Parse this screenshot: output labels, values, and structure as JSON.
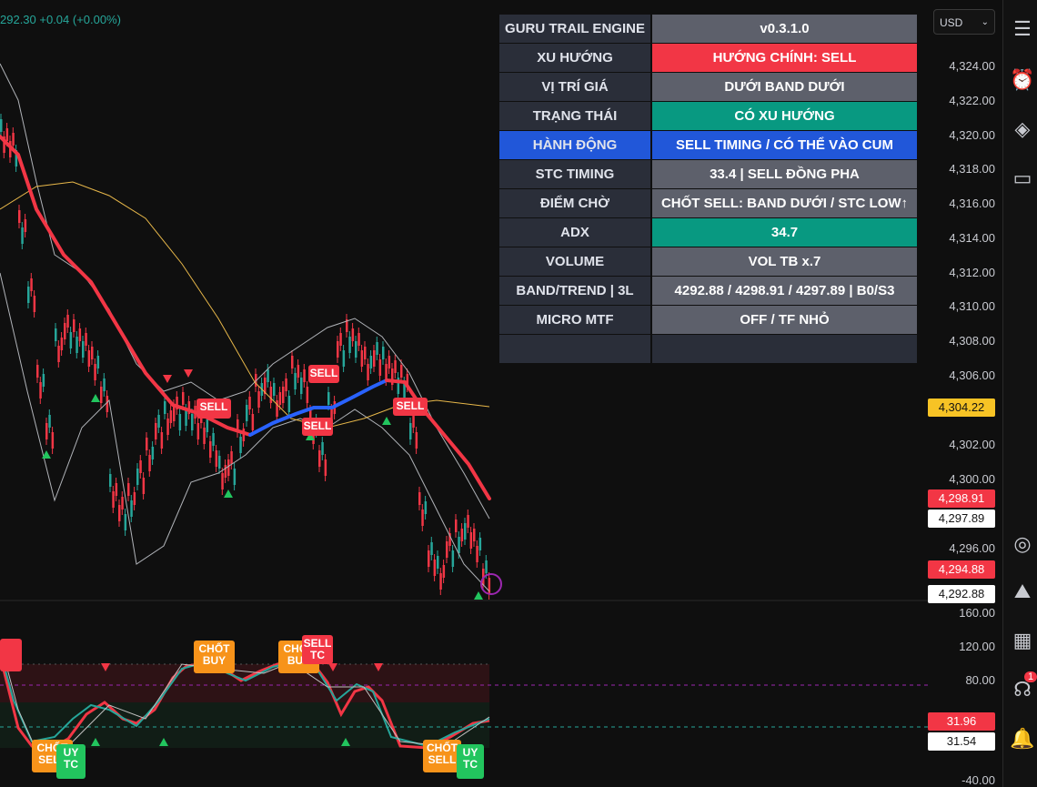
{
  "header": {
    "quote_text": "292.30 +0.04 (+0.00%)"
  },
  "currency": {
    "value": "USD"
  },
  "table": {
    "rows": [
      {
        "label": "GURU TRAIL ENGINE",
        "value": "v0.3.1.0",
        "value_color": "#5d606b"
      },
      {
        "label": "XU HƯỚNG",
        "value": "HƯỚNG CHÍNH: SELL",
        "value_color": "#f23645"
      },
      {
        "label": "VỊ TRÍ GIÁ",
        "value": "DƯỚI BAND DƯỚI",
        "value_color": "#5d606b"
      },
      {
        "label": "TRẠNG THÁI",
        "value": "CÓ XU HƯỚNG",
        "value_color": "#089981"
      },
      {
        "label": "HÀNH ĐỘNG",
        "value": "SELL TIMING / CÓ THỂ VÀO CUM",
        "value_color": "#2157d9"
      },
      {
        "label": "STC TIMING",
        "value": "33.4 | SELL ĐỒNG PHA",
        "value_color": "#5d606b"
      },
      {
        "label": "ĐIỂM CHỜ",
        "value": "CHỐT SELL: BAND DƯỚI / STC LOW↑",
        "value_color": "#5d606b"
      },
      {
        "label": "ADX",
        "value": "34.7",
        "value_color": "#089981"
      },
      {
        "label": "VOLUME",
        "value": "VOL TB x.7",
        "value_color": "#5d606b"
      },
      {
        "label": "BAND/TREND | 3L",
        "value": "4292.88 / 4298.91 / 4297.89 | B0/S3",
        "value_color": "#5d606b"
      },
      {
        "label": "MICRO MTF",
        "value": "OFF / TF NHỎ",
        "value_color": "#5d606b"
      },
      {
        "label": "",
        "value": "",
        "value_color": "#2a2e39"
      }
    ]
  },
  "price_axis": {
    "ticks": [
      "4,324.00",
      "4,322.00",
      "4,320.00",
      "4,318.00",
      "4,316.00",
      "4,314.00",
      "4,312.00",
      "4,310.00",
      "4,308.00",
      "4,306.00",
      "4,302.00",
      "4,300.00",
      "4,296.00"
    ],
    "tags": [
      {
        "text": "4,304.22",
        "bg": "#f7c325",
        "fg": "#131313"
      },
      {
        "text": "4,298.91",
        "bg": "#f23645",
        "fg": "#ffffff"
      },
      {
        "text": "4,297.89",
        "bg": "#ffffff",
        "fg": "#131313"
      },
      {
        "text": "4,294.88",
        "bg": "#f23645",
        "fg": "#ffffff"
      },
      {
        "text": "4,292.88",
        "bg": "#ffffff",
        "fg": "#131313"
      }
    ]
  },
  "osc_axis": {
    "ticks": [
      "160.00",
      "120.00",
      "80.00",
      "-40.00"
    ],
    "tags": [
      {
        "text": "31.96",
        "bg": "#f23645",
        "fg": "#ffffff"
      },
      {
        "text": "31.54",
        "bg": "#ffffff",
        "fg": "#131313"
      }
    ]
  },
  "chart_labels": {
    "sell": "SELL",
    "chot_buy": "CHỐT BUY",
    "chot_sell": "CHỐT SELL",
    "buy_stc": "BUY STC",
    "sell_stc": "SELL STC"
  },
  "toolbar": {
    "badge_count": "1"
  },
  "colors": {
    "up": "#26a69a",
    "down": "#f23645",
    "trend_down": "#f23645",
    "trend_up": "#2962ff"
  }
}
